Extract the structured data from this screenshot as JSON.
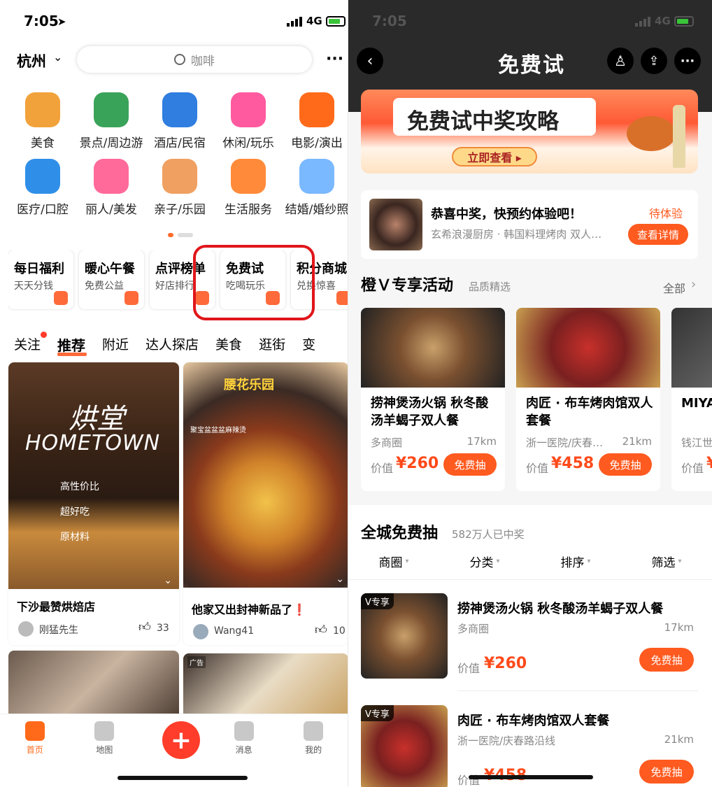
{
  "status": {
    "time": "7:05",
    "network": "4G"
  },
  "left": {
    "city": "杭州",
    "search_placeholder": "咖啡",
    "categories": [
      {
        "label": "美食",
        "icon": "roast-chicken-icon"
      },
      {
        "label": "景点/周边游",
        "icon": "pagoda-icon"
      },
      {
        "label": "酒店/民宿",
        "icon": "hotel-building-icon"
      },
      {
        "label": "休闲/玩乐",
        "icon": "cocktail-icon"
      },
      {
        "label": "电影/演出",
        "icon": "cat-mask-icon"
      },
      {
        "label": "医疗/口腔",
        "icon": "medical-kit-icon"
      },
      {
        "label": "丽人/美发",
        "icon": "beauty-woman-icon"
      },
      {
        "label": "亲子/乐园",
        "icon": "parent-child-icon"
      },
      {
        "label": "生活服务",
        "icon": "cleaning-spray-icon"
      },
      {
        "label": "结婚/婚纱照",
        "icon": "diamond-ring-icon"
      }
    ],
    "promos": [
      {
        "title": "每日福利",
        "sub": "天天分钱"
      },
      {
        "title": "暖心午餐",
        "sub": "免费公益"
      },
      {
        "title": "点评榜单",
        "sub": "好店排行"
      },
      {
        "title": "免费试",
        "sub": "吃喝玩乐"
      },
      {
        "title": "积分商城",
        "sub": "兑换惊喜"
      }
    ],
    "tabs": [
      "关注",
      "推荐",
      "附近",
      "达人探店",
      "美食",
      "逛街",
      "变"
    ],
    "feed": [
      {
        "title": "下沙最赞烘焙店",
        "author": "刚猛先生",
        "likes": "33",
        "overlay_title": "烘堂",
        "overlay_sub": "HOMETOWN",
        "overlay_items": [
          "高性价比",
          "超好吃",
          "原材料"
        ]
      },
      {
        "title": "他家又出封神新品了❗",
        "author": "Wang41",
        "likes": "10",
        "overlay_title": "腰花乐园",
        "overlay_sub": "聚宝盆盆盆麻辣烫"
      }
    ],
    "ad_label": "广告",
    "bottom_nav": [
      "首页",
      "地图",
      "",
      "消息",
      "我的"
    ]
  },
  "right": {
    "title": "免费试",
    "banner": {
      "title": "免费试中奖攻略",
      "button": "立即查看 ▸"
    },
    "win": {
      "title": "恭喜中奖，快预约体验吧！",
      "status": "待体验",
      "desc": "玄希浪漫厨房 · 韩国料理烤肉 双人…",
      "button": "查看详情"
    },
    "vip": {
      "title": "橙Ｖ专享活动",
      "subtitle": "品质精选",
      "all": "全部",
      "cards": [
        {
          "name": "捞神煲汤火锅 秋冬酸汤羊蝎子双人餐",
          "area": "多商圈",
          "dist": "17km",
          "price_label": "价值",
          "price": "¥260",
          "button": "免费抽"
        },
        {
          "name": "肉匠 · 布车烤肉馆双人套餐",
          "area": "浙一医院/庆春…",
          "dist": "21km",
          "price_label": "价值",
          "price": "¥458",
          "button": "免费抽"
        },
        {
          "name": "MIYA（奥体",
          "area": "钱江世",
          "dist": "",
          "price_label": "价值",
          "price": "¥",
          "button": ""
        }
      ]
    },
    "city": {
      "title": "全城免费抽",
      "count": "582万人已中奖",
      "filters": [
        "商圈",
        "分类",
        "排序",
        "筛选"
      ],
      "items": [
        {
          "badge": "V专享",
          "name": "捞神煲汤火锅 秋冬酸汤羊蝎子双人餐",
          "area": "多商圈",
          "dist": "17km",
          "price_label": "价值",
          "price": "¥260",
          "button": "免费抽"
        },
        {
          "badge": "V专享",
          "name": "肉匠 · 布车烤肉馆双人套餐",
          "area": "浙一医院/庆春路沿线",
          "dist": "21km",
          "price_label": "价值",
          "price": "¥458",
          "button": "免费抽"
        }
      ]
    }
  },
  "colors": {
    "accent": "#ff5a1f",
    "highlight": "#e0161b",
    "dark_header": "#2a2a2a"
  }
}
